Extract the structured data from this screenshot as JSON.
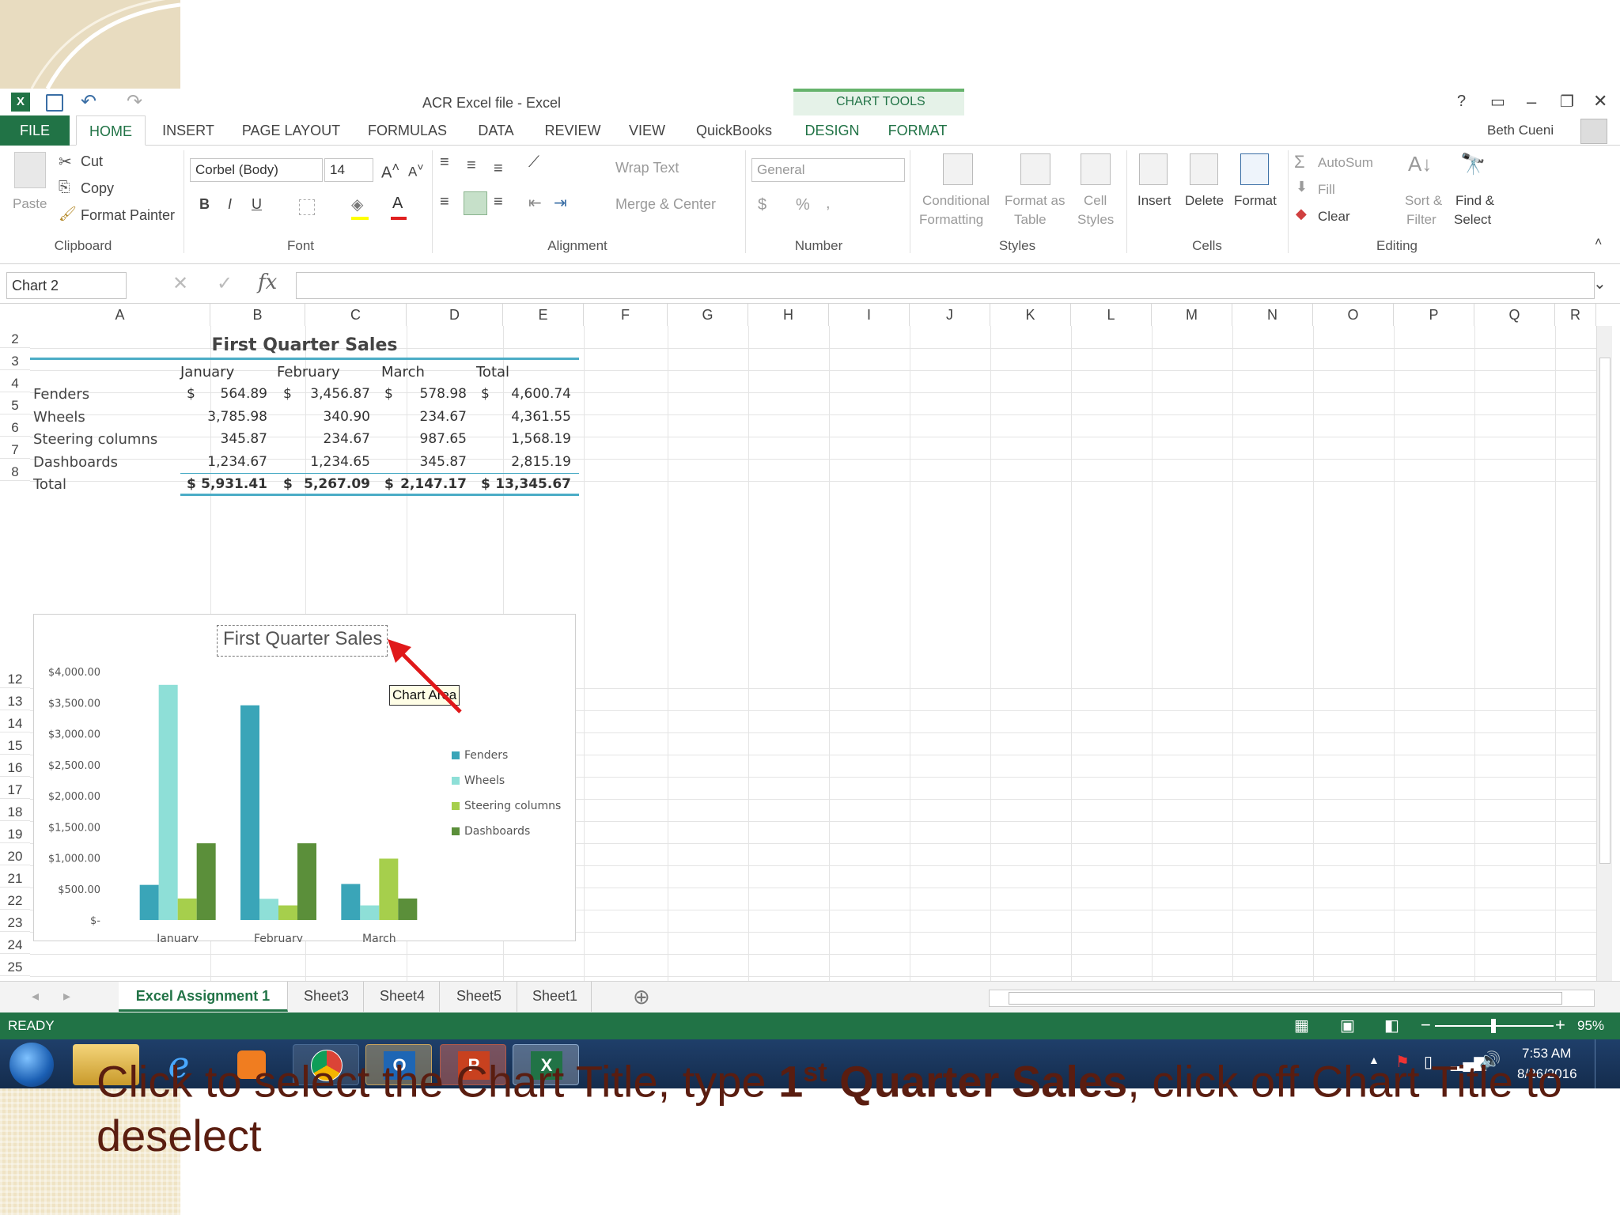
{
  "window": {
    "title": "ACR Excel file - Excel",
    "context_tab": "CHART TOOLS",
    "user": "Beth Cueni",
    "controls": [
      "?",
      "▭",
      "–",
      "❐",
      "✕"
    ]
  },
  "tabs": [
    "FILE",
    "HOME",
    "INSERT",
    "PAGE LAYOUT",
    "FORMULAS",
    "DATA",
    "REVIEW",
    "VIEW",
    "QuickBooks",
    "DESIGN",
    "FORMAT"
  ],
  "ribbon": {
    "clipboard": {
      "paste": "Paste",
      "cut": "Cut",
      "copy": "Copy",
      "format_painter": "Format Painter",
      "label": "Clipboard"
    },
    "font": {
      "name": "Corbel (Body)",
      "size": "14",
      "bold": "B",
      "italic": "I",
      "underline": "U",
      "label": "Font"
    },
    "alignment": {
      "wrap": "Wrap Text",
      "merge": "Merge & Center",
      "label": "Alignment"
    },
    "number": {
      "format": "General",
      "currency": "$",
      "percent": "%",
      "comma": ",",
      "label": "Number"
    },
    "styles": {
      "conditional_1": "Conditional",
      "conditional_2": "Formatting",
      "format_table_1": "Format as",
      "format_table_2": "Table",
      "cell_styles_1": "Cell",
      "cell_styles_2": "Styles",
      "label": "Styles"
    },
    "cells": {
      "insert": "Insert",
      "delete": "Delete",
      "format": "Format",
      "label": "Cells"
    },
    "editing": {
      "autosum": "AutoSum",
      "fill": "Fill",
      "clear": "Clear",
      "sort_1": "Sort &",
      "sort_2": "Filter",
      "find_1": "Find &",
      "find_2": "Select",
      "label": "Editing"
    }
  },
  "formula_bar": {
    "name_box": "Chart 2",
    "fx": "fx",
    "content": ""
  },
  "columns": [
    "A",
    "B",
    "C",
    "D",
    "E",
    "F",
    "G",
    "H",
    "I",
    "J",
    "K",
    "L",
    "M",
    "N",
    "O",
    "P",
    "Q",
    "R"
  ],
  "rows": [
    "2",
    "3",
    "4",
    "5",
    "6",
    "7",
    "8",
    "12",
    "13",
    "14",
    "15",
    "16",
    "17",
    "18",
    "19",
    "20",
    "21",
    "22",
    "23",
    "24",
    "25"
  ],
  "table": {
    "title": "First Quarter Sales",
    "headers": [
      "January",
      "February",
      "March",
      "Total"
    ],
    "rows": [
      {
        "label": "Fenders",
        "c1": "564.89",
        "c2": "3,456.87",
        "c3": "578.98",
        "c4": "4,600.74",
        "cur": true
      },
      {
        "label": "Wheels",
        "c1": "3,785.98",
        "c2": "340.90",
        "c3": "234.67",
        "c4": "4,361.55",
        "cur": false
      },
      {
        "label": "Steering columns",
        "c1": "345.87",
        "c2": "234.67",
        "c3": "987.65",
        "c4": "1,568.19",
        "cur": false
      },
      {
        "label": "Dashboards",
        "c1": "1,234.67",
        "c2": "1,234.65",
        "c3": "345.87",
        "c4": "2,815.19",
        "cur": false
      },
      {
        "label": "Total",
        "c1": "5,931.41",
        "c2": "5,267.09",
        "c3": "2,147.17",
        "c4": "13,345.67",
        "cur": true
      }
    ],
    "currency_symbol": "$"
  },
  "tooltip": "Chart Area",
  "chart_data": {
    "type": "bar",
    "title": "First Quarter Sales",
    "categories": [
      "January",
      "February",
      "March"
    ],
    "series": [
      {
        "name": "Fenders",
        "values": [
          564.89,
          3456.87,
          578.98
        ],
        "color": "#3aa5b8"
      },
      {
        "name": "Wheels",
        "values": [
          3785.98,
          340.9,
          234.67
        ],
        "color": "#8edfd7"
      },
      {
        "name": "Steering columns",
        "values": [
          345.87,
          234.67,
          987.65
        ],
        "color": "#a6cf4c"
      },
      {
        "name": "Dashboards",
        "values": [
          1234.67,
          1234.65,
          345.87
        ],
        "color": "#5b8f3a"
      }
    ],
    "yticks": [
      "$4,000.00",
      "$3,500.00",
      "$3,000.00",
      "$2,500.00",
      "$2,000.00",
      "$1,500.00",
      "$1,000.00",
      "$500.00",
      "$-"
    ],
    "ylim": [
      0,
      4000
    ],
    "legend": "right"
  },
  "sheets": [
    "Excel Assignment 1",
    "Sheet3",
    "Sheet4",
    "Sheet5",
    "Sheet1"
  ],
  "status": {
    "ready": "READY",
    "zoom": "95%",
    "zoom_level": 0.95
  },
  "clock": {
    "time": "7:53 AM",
    "date": "8/26/2016"
  },
  "caption": {
    "p1": "Click to select the Chart Title, type ",
    "bold1": "1",
    "sup": "st",
    "bold2": " Quarter Sales",
    "p2": ", click off Chart Title to deselect"
  },
  "colors": {
    "excel_green": "#217346",
    "accent_teal": "#4bacc6",
    "caption": "#5a1d10"
  }
}
